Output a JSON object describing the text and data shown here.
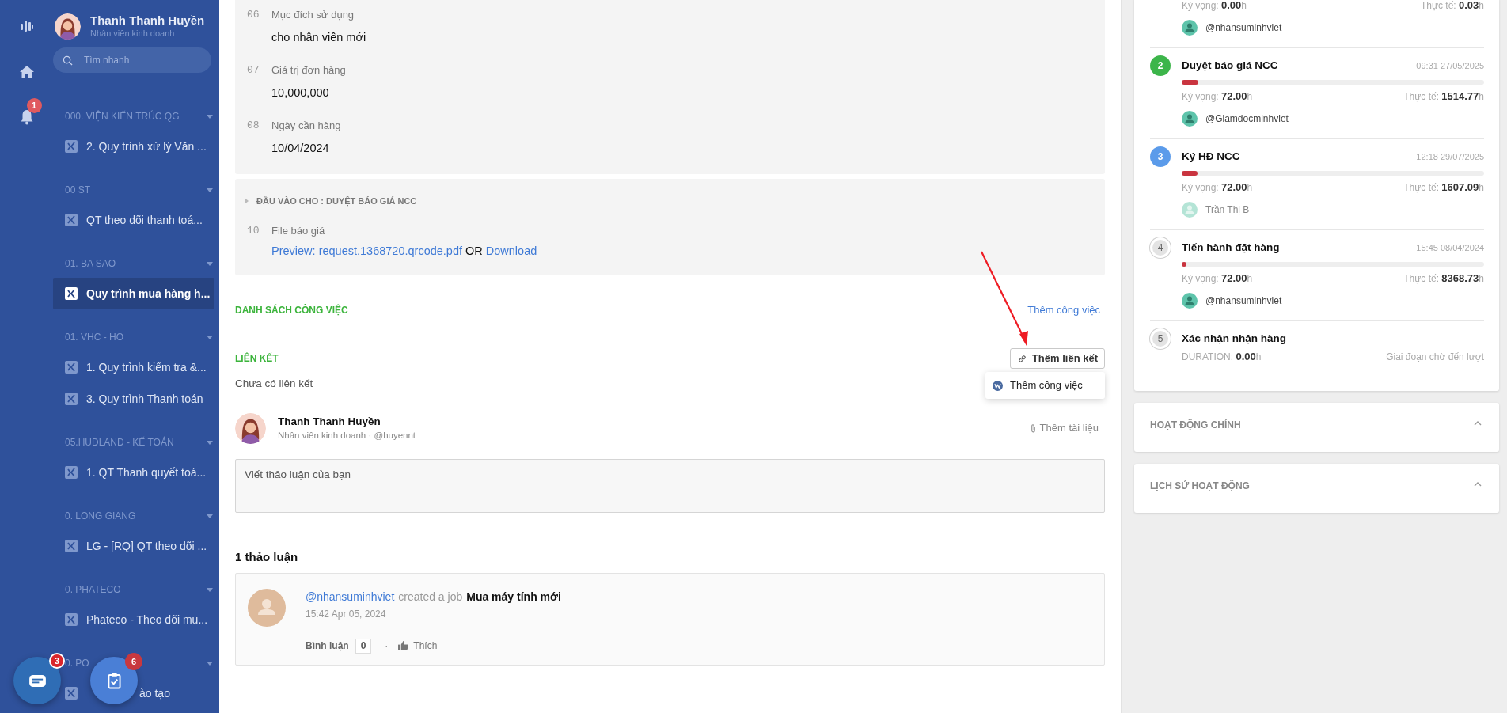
{
  "rail": {
    "notification_badge": "1"
  },
  "profile": {
    "name": "Thanh Thanh Huyền",
    "role": "Nhân viên kinh doanh"
  },
  "search": {
    "placeholder": "Tìm nhanh"
  },
  "groups": [
    {
      "title": "000. VIỆN KIẾN TRÚC QG",
      "items": [
        {
          "label": "2. Quy trình xử lý Văn ...",
          "selected": false
        }
      ]
    },
    {
      "title": "00 ST",
      "items": [
        {
          "label": "QT theo dõi thanh toá...",
          "selected": false
        }
      ]
    },
    {
      "title": "01. BA SAO",
      "items": [
        {
          "label": "Quy trình mua hàng h...",
          "selected": true
        }
      ]
    },
    {
      "title": "01. VHC - HO",
      "items": [
        {
          "label": "1. Quy trình kiểm tra &...",
          "selected": false
        },
        {
          "label": "3. Quy trình Thanh toán",
          "selected": false
        }
      ]
    },
    {
      "title": "05.HUDLAND - KẾ TOÁN",
      "items": [
        {
          "label": "1. QT Thanh quyết toá...",
          "selected": false
        }
      ]
    },
    {
      "title": "0. LONG GIANG",
      "items": [
        {
          "label": "LG - [RQ] QT theo dõi ...",
          "selected": false
        }
      ]
    },
    {
      "title": "0. PHATECO",
      "items": [
        {
          "label": "Phateco - Theo dõi mu...",
          "selected": false
        }
      ]
    },
    {
      "title": "0. PO",
      "items": [
        {
          "label": "ào tạo",
          "selected": false,
          "kind": "cut"
        }
      ]
    }
  ],
  "fabs": [
    {
      "kind": "chat",
      "badge": "3"
    },
    {
      "kind": "tasks",
      "badge": "6"
    }
  ],
  "fields": [
    {
      "number": "06",
      "label": "Mục đích sử dụng",
      "value": "cho nhân viên mới"
    },
    {
      "number": "07",
      "label": "Giá trị đơn hàng",
      "value": "10,000,000"
    },
    {
      "number": "08",
      "label": "Ngày cần hàng",
      "value": "10/04/2024"
    }
  ],
  "input_section": {
    "title": "ĐẦU VÀO CHO : DUYỆT BÁO GIÁ NCC",
    "field": {
      "number": "10",
      "label": "File báo giá",
      "preview": "Preview: request.1368720.qrcode.pdf",
      "separator": "OR",
      "download": "Download"
    }
  },
  "tasks_section": {
    "title": "DANH SÁCH CÔNG VIỆC",
    "action": "Thêm công việc"
  },
  "links_section": {
    "title": "LIÊN KẾT",
    "action": "Thêm liên kết",
    "empty": "Chưa có liên kết",
    "menu": [
      {
        "label": "Thêm công việc"
      }
    ]
  },
  "composer": {
    "name": "Thanh Thanh Huyền",
    "subtitle": "Nhân viên kinh doanh · @huyennt",
    "attach": "Thêm tài liệu",
    "placeholder": "Viết thảo luận của bạn"
  },
  "discussion": {
    "count": "1 thảo luận",
    "posts": [
      {
        "user": "@nhansuminhviet",
        "action": "created a job",
        "object": "Mua máy tính mới",
        "time": "15:42 Apr 05, 2024",
        "comment_label": "Bình luận",
        "comment_count": "0",
        "separator": "·",
        "like": "Thích"
      }
    ]
  },
  "steps": [
    {
      "kind": "partial",
      "expected": "Kỳ vọng: **0.00**h",
      "actual": "Thực tế: **0.03**h",
      "assignee": "@nhansuminhviet",
      "assignee_active": true
    },
    {
      "kind": "step",
      "color": "#3cb54a",
      "reached": true,
      "number": "2",
      "title": "Duyệt báo giá NCC",
      "time": "09:31 27/05/2025",
      "level": 0.055,
      "expected": "Kỳ vọng: **72.00**h",
      "actual": "Thực tế: **1514.77**h",
      "assignee": "@Giamdocminhviet",
      "assignee_active": true
    },
    {
      "kind": "step",
      "color": "#5b9bea",
      "reached": true,
      "number": "3",
      "title": "Ký HĐ NCC",
      "time": "12:18 29/07/2025",
      "level": 0.052,
      "expected": "Kỳ vọng: **72.00**h",
      "actual": "Thực tế: **1607.09**h",
      "assignee": "Trần Thị B",
      "assignee_active": false
    },
    {
      "kind": "step",
      "color": "#e3e3e3",
      "reached": false,
      "number": "4",
      "title": "Tiến hành đặt hàng",
      "time": "15:45 08/04/2024",
      "level": 0.012,
      "expected": "Kỳ vọng: **72.00**h",
      "actual": "Thực tế: **8368.73**h",
      "assignee": "@nhansuminhviet",
      "assignee_active": true
    },
    {
      "kind": "waiting",
      "color": "#e3e3e3",
      "reached": false,
      "number": "5",
      "title": "Xác nhận nhận hàng",
      "duration": "DURATION: **0.00**h",
      "note": "Giai đoạn chờ đến lượt"
    }
  ],
  "panels": [
    {
      "title": "HOẠT ĐỘNG CHÍNH"
    },
    {
      "title": "LỊCH SỬ HOẠT ĐỘNG"
    }
  ]
}
